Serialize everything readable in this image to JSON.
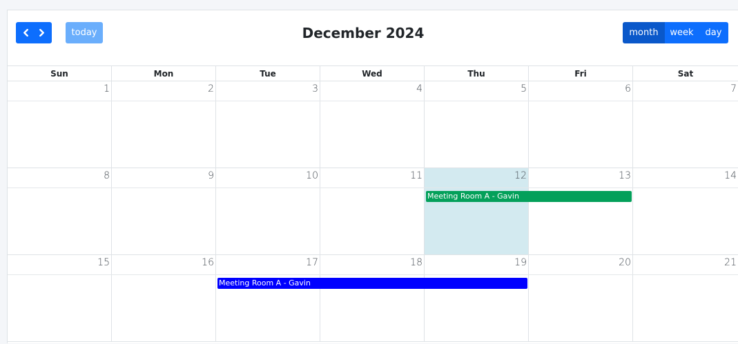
{
  "toolbar": {
    "prev_icon": "chevron-left-icon",
    "next_icon": "chevron-right-icon",
    "today_label": "today",
    "title": "December 2024",
    "views": [
      "month",
      "week",
      "day"
    ],
    "active_view": "month"
  },
  "weekdays": [
    "Sun",
    "Mon",
    "Tue",
    "Wed",
    "Thu",
    "Fri",
    "Sat"
  ],
  "weeks": [
    [
      "1",
      "2",
      "3",
      "4",
      "5",
      "6",
      "7"
    ],
    [
      "8",
      "9",
      "10",
      "11",
      "12",
      "13",
      "14"
    ],
    [
      "15",
      "16",
      "17",
      "18",
      "19",
      "20",
      "21"
    ]
  ],
  "today_date": "12",
  "events": [
    {
      "title": "Meeting Room A - Gavin",
      "start": "12",
      "end": "13",
      "color": "#03a05a"
    },
    {
      "title": "Meeting Room A - Gavin",
      "start": "17",
      "end": "19",
      "color": "#0000ff"
    }
  ],
  "colors": {
    "primary": "#0d6efd",
    "primary_active": "#0a58ca",
    "today_button": "#6aaefc",
    "today_highlight": "#d3eaf0"
  }
}
